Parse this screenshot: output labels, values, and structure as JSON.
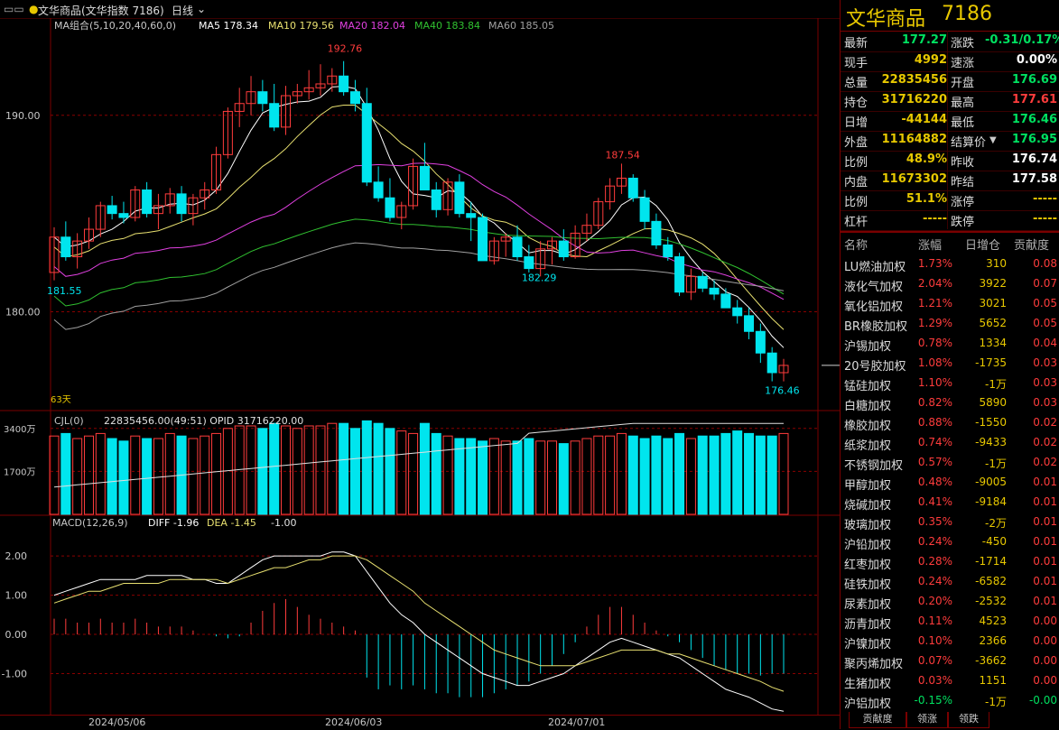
{
  "topbar": {
    "title": "文华商品(文华指数 7186)",
    "period": "日线"
  },
  "indicators": {
    "ma_group": "MA组合(5,10,20,40,60,0)",
    "ma5": "MA5 178.34",
    "ma10": "MA10 179.56",
    "ma20": "MA20 182.04",
    "ma40": "MA40 183.84",
    "ma60": "MA60 185.05",
    "cjl": "CJL(0)",
    "cjl_values": "22835456.00(49:51)  OPID 31716220.00",
    "macd": "MACD(12,26,9)",
    "diff": "DIFF -1.96",
    "dea": "DEA -1.45",
    "macd_val": "-1.00",
    "days": "63天"
  },
  "colors": {
    "up": "#ff3c3c",
    "down": "#00e5ee",
    "ma5": "#ffffff",
    "ma10": "#e8e070",
    "ma20": "#e040e0",
    "ma40": "#30c030",
    "ma60": "#a0a0a0",
    "yellow": "#e8c800",
    "green": "#00e060",
    "red": "#ff3c3c"
  },
  "chart_data": {
    "type": "candlestick",
    "y_ticks": [
      "190.00",
      "180.00"
    ],
    "volume_ticks": [
      "3400万",
      "1700万"
    ],
    "macd_ticks": [
      "2.00",
      "1.00",
      "0.00",
      "-1.00"
    ],
    "x_labels": [
      "2024/05/06",
      "2024/06/03",
      "2024/07/01"
    ],
    "annotations": {
      "high": "192.76",
      "mid_high": "187.54",
      "low_start": "181.55",
      "mid_low": "182.29",
      "last_low": "176.46"
    },
    "ylim": [
      175.2,
      194.4
    ],
    "candles": [
      [
        182.0,
        184.3,
        181.6,
        183.8
      ],
      [
        183.8,
        184.6,
        182.6,
        182.8
      ],
      [
        182.8,
        184.0,
        182.2,
        183.6
      ],
      [
        183.6,
        184.8,
        183.2,
        184.2
      ],
      [
        184.2,
        185.6,
        183.8,
        185.4
      ],
      [
        185.4,
        185.9,
        184.7,
        185.0
      ],
      [
        185.0,
        185.6,
        184.5,
        184.8
      ],
      [
        184.8,
        186.4,
        184.6,
        186.2
      ],
      [
        186.2,
        186.6,
        184.8,
        185.0
      ],
      [
        185.0,
        186.0,
        184.2,
        185.4
      ],
      [
        185.4,
        186.3,
        185.0,
        186.0
      ],
      [
        186.0,
        186.4,
        184.6,
        185.0
      ],
      [
        185.0,
        186.0,
        184.4,
        185.8
      ],
      [
        185.8,
        186.6,
        185.2,
        186.2
      ],
      [
        186.2,
        188.4,
        186.0,
        188.0
      ],
      [
        188.0,
        190.4,
        187.8,
        190.2
      ],
      [
        190.2,
        191.4,
        189.4,
        190.6
      ],
      [
        190.6,
        192.0,
        190.0,
        191.2
      ],
      [
        191.2,
        191.8,
        190.2,
        190.6
      ],
      [
        190.6,
        191.6,
        189.2,
        189.4
      ],
      [
        189.4,
        191.5,
        189.0,
        191.0
      ],
      [
        191.0,
        191.6,
        190.6,
        191.2
      ],
      [
        191.2,
        192.3,
        190.8,
        191.4
      ],
      [
        191.4,
        192.6,
        191.0,
        191.6
      ],
      [
        191.6,
        192.4,
        191.2,
        192.0
      ],
      [
        192.0,
        192.76,
        191.0,
        191.2
      ],
      [
        191.2,
        191.8,
        190.2,
        190.6
      ],
      [
        190.6,
        191.4,
        186.4,
        186.6
      ],
      [
        186.6,
        187.4,
        185.6,
        185.8
      ],
      [
        185.8,
        186.8,
        184.6,
        184.8
      ],
      [
        184.8,
        185.6,
        184.2,
        185.4
      ],
      [
        185.4,
        187.8,
        185.2,
        187.4
      ],
      [
        187.4,
        188.6,
        186.6,
        186.2
      ],
      [
        186.2,
        186.6,
        184.8,
        185.2
      ],
      [
        185.2,
        186.8,
        184.9,
        186.6
      ],
      [
        186.6,
        187.0,
        184.8,
        185.0
      ],
      [
        185.0,
        185.6,
        183.6,
        184.8
      ],
      [
        184.8,
        185.0,
        182.6,
        182.6
      ],
      [
        182.6,
        183.8,
        182.4,
        183.6
      ],
      [
        183.6,
        184.0,
        182.8,
        183.8
      ],
      [
        183.8,
        184.4,
        182.6,
        182.8
      ],
      [
        182.8,
        183.4,
        182.0,
        182.2
      ],
      [
        182.2,
        183.6,
        181.8,
        183.2
      ],
      [
        183.2,
        183.8,
        182.4,
        183.6
      ],
      [
        183.6,
        184.2,
        182.6,
        182.8
      ],
      [
        182.8,
        184.4,
        182.7,
        184.0
      ],
      [
        184.0,
        185.0,
        183.6,
        184.4
      ],
      [
        184.4,
        185.8,
        184.2,
        185.6
      ],
      [
        185.6,
        186.8,
        185.2,
        186.4
      ],
      [
        186.4,
        187.54,
        186.0,
        186.8
      ],
      [
        186.8,
        187.0,
        185.6,
        185.8
      ],
      [
        185.8,
        186.2,
        184.2,
        184.6
      ],
      [
        184.6,
        185.0,
        183.2,
        183.4
      ],
      [
        183.4,
        183.8,
        182.6,
        182.8
      ],
      [
        182.8,
        183.0,
        180.8,
        181.0
      ],
      [
        181.0,
        182.2,
        180.6,
        181.8
      ],
      [
        181.8,
        182.0,
        181.0,
        181.2
      ],
      [
        181.2,
        181.6,
        180.6,
        180.9
      ],
      [
        180.9,
        181.2,
        180.4,
        180.2
      ],
      [
        180.2,
        180.6,
        179.4,
        179.8
      ],
      [
        179.8,
        180.2,
        178.6,
        179.0
      ],
      [
        179.0,
        179.4,
        177.4,
        177.9
      ],
      [
        177.9,
        178.2,
        176.46,
        176.9
      ],
      [
        176.9,
        177.6,
        176.46,
        177.27
      ]
    ],
    "volume": [
      62,
      64,
      60,
      62,
      64,
      60,
      58,
      62,
      60,
      60,
      64,
      62,
      60,
      62,
      64,
      68,
      70,
      70,
      68,
      72,
      70,
      68,
      70,
      70,
      72,
      72,
      68,
      74,
      72,
      68,
      66,
      64,
      72,
      64,
      62,
      60,
      60,
      58,
      60,
      58,
      58,
      60,
      58,
      58,
      56,
      58,
      60,
      62,
      62,
      64,
      62,
      60,
      62,
      60,
      64,
      60,
      62,
      62,
      64,
      66,
      64,
      62,
      62,
      64
    ],
    "macd_hist": [
      0.4,
      0.4,
      0.3,
      0.3,
      0.4,
      0.3,
      0.3,
      0.4,
      0.3,
      0.2,
      0.2,
      0.2,
      0.1,
      0.0,
      -0.05,
      -0.1,
      -0.05,
      0.3,
      0.6,
      0.8,
      0.9,
      0.7,
      0.5,
      0.4,
      0.3,
      0.2,
      0.1,
      -1.1,
      -1.4,
      -1.3,
      -1.4,
      -1.3,
      -1.4,
      -1.5,
      -1.5,
      -1.6,
      -1.6,
      -1.6,
      -1.5,
      -1.4,
      -1.3,
      -1.2,
      -1.0,
      -0.8,
      -0.5,
      -0.2,
      0.2,
      0.5,
      0.7,
      0.7,
      0.5,
      0.3,
      0.1,
      -0.05,
      -0.2,
      -0.4,
      -0.6,
      -0.8,
      -0.9,
      -1.0,
      -1.0,
      -1.05,
      -1.0,
      -1.0
    ],
    "diff_line": [
      1.0,
      1.1,
      1.2,
      1.3,
      1.4,
      1.4,
      1.4,
      1.4,
      1.5,
      1.5,
      1.5,
      1.5,
      1.4,
      1.4,
      1.3,
      1.3,
      1.5,
      1.7,
      1.9,
      2.0,
      2.0,
      2.0,
      2.0,
      2.0,
      2.1,
      2.1,
      2.0,
      1.6,
      1.2,
      0.8,
      0.5,
      0.3,
      0.0,
      -0.2,
      -0.4,
      -0.6,
      -0.8,
      -1.0,
      -1.1,
      -1.2,
      -1.3,
      -1.3,
      -1.2,
      -1.1,
      -1.0,
      -0.8,
      -0.6,
      -0.4,
      -0.2,
      -0.1,
      -0.2,
      -0.3,
      -0.4,
      -0.5,
      -0.6,
      -0.8,
      -1.0,
      -1.2,
      -1.4,
      -1.5,
      -1.6,
      -1.75,
      -1.9,
      -1.96
    ],
    "dea_line": [
      0.8,
      0.9,
      1.0,
      1.1,
      1.1,
      1.2,
      1.3,
      1.3,
      1.3,
      1.3,
      1.4,
      1.4,
      1.4,
      1.4,
      1.4,
      1.3,
      1.4,
      1.5,
      1.6,
      1.7,
      1.7,
      1.8,
      1.9,
      1.9,
      2.0,
      2.0,
      2.0,
      1.9,
      1.7,
      1.5,
      1.3,
      1.1,
      0.8,
      0.6,
      0.4,
      0.2,
      0.0,
      -0.2,
      -0.4,
      -0.5,
      -0.6,
      -0.7,
      -0.8,
      -0.8,
      -0.8,
      -0.8,
      -0.7,
      -0.6,
      -0.5,
      -0.4,
      -0.4,
      -0.4,
      -0.4,
      -0.5,
      -0.5,
      -0.6,
      -0.7,
      -0.8,
      -0.9,
      -1.0,
      -1.1,
      -1.2,
      -1.35,
      -1.45
    ]
  },
  "quote": {
    "title": "文华商品",
    "code": "7186",
    "rows": [
      {
        "l1": "最新",
        "v1": "177.27",
        "c1": "#00e060",
        "l2": "涨跌",
        "v2": "-0.31/0.17%",
        "c2": "#00e060"
      },
      {
        "l1": "现手",
        "v1": "4992",
        "c1": "#e8c800",
        "l2": "速涨",
        "v2": "0.00%",
        "c2": "#ffffff"
      },
      {
        "l1": "总量",
        "v1": "22835456",
        "c1": "#e8c800",
        "l2": "开盘",
        "v2": "176.69",
        "c2": "#00e060"
      },
      {
        "l1": "持仓",
        "v1": "31716220",
        "c1": "#e8c800",
        "l2": "最高",
        "v2": "177.61",
        "c2": "#ff3c3c"
      },
      {
        "l1": "日增",
        "v1": "-44144",
        "c1": "#e8c800",
        "l2": "最低",
        "v2": "176.46",
        "c2": "#00e060"
      },
      {
        "l1": "外盘",
        "v1": "11164882",
        "c1": "#e8c800",
        "l2": "结算价",
        "v2": "176.95",
        "c2": "#00e060"
      },
      {
        "l1": "比例",
        "v1": "48.9%",
        "c1": "#e8c800",
        "l2": "昨收",
        "v2": "176.74",
        "c2": "#ffffff"
      },
      {
        "l1": "内盘",
        "v1": "11673302",
        "c1": "#e8c800",
        "l2": "昨结",
        "v2": "177.58",
        "c2": "#ffffff"
      },
      {
        "l1": "比例",
        "v1": "51.1%",
        "c1": "#e8c800",
        "l2": "涨停",
        "v2": "-----",
        "c2": "#e8c800"
      },
      {
        "l1": "杠杆",
        "v1": "-----",
        "c1": "#e8c800",
        "l2": "跌停",
        "v2": "-----",
        "c2": "#e8c800"
      }
    ]
  },
  "contrib_table": {
    "headers": [
      "名称",
      "涨幅",
      "日增仓",
      "贡献度"
    ],
    "rows": [
      [
        "LU燃油加权",
        "1.73%",
        "310",
        "0.08"
      ],
      [
        "液化气加权",
        "2.04%",
        "3922",
        "0.07"
      ],
      [
        "氧化铝加权",
        "1.21%",
        "3021",
        "0.05"
      ],
      [
        "BR橡胶加权",
        "1.29%",
        "5652",
        "0.05"
      ],
      [
        "沪锡加权",
        "0.78%",
        "1334",
        "0.04"
      ],
      [
        "20号胶加权",
        "1.08%",
        "-1735",
        "0.03"
      ],
      [
        "锰硅加权",
        "1.10%",
        "-1万",
        "0.03"
      ],
      [
        "白糖加权",
        "0.82%",
        "5890",
        "0.03"
      ],
      [
        "橡胶加权",
        "0.88%",
        "-1550",
        "0.02"
      ],
      [
        "纸浆加权",
        "0.74%",
        "-9433",
        "0.02"
      ],
      [
        "不锈钢加权",
        "0.57%",
        "-1万",
        "0.02"
      ],
      [
        "甲醇加权",
        "0.48%",
        "-9005",
        "0.01"
      ],
      [
        "烧碱加权",
        "0.41%",
        "-9184",
        "0.01"
      ],
      [
        "玻璃加权",
        "0.35%",
        "-2万",
        "0.01"
      ],
      [
        "沪铅加权",
        "0.24%",
        "-450",
        "0.01"
      ],
      [
        "红枣加权",
        "0.28%",
        "-1714",
        "0.01"
      ],
      [
        "硅铁加权",
        "0.24%",
        "-6582",
        "0.01"
      ],
      [
        "尿素加权",
        "0.20%",
        "-2532",
        "0.01"
      ],
      [
        "沥青加权",
        "0.11%",
        "4523",
        "0.00"
      ],
      [
        "沪镍加权",
        "0.10%",
        "2366",
        "0.00"
      ],
      [
        "聚丙烯加权",
        "0.07%",
        "-3662",
        "0.00"
      ],
      [
        "生猪加权",
        "0.03%",
        "1151",
        "0.00"
      ],
      [
        "沪铝加权",
        "-0.15%",
        "-1万",
        "-0.00"
      ]
    ]
  },
  "tabs": [
    "贡献度",
    "领涨",
    "领跌"
  ]
}
